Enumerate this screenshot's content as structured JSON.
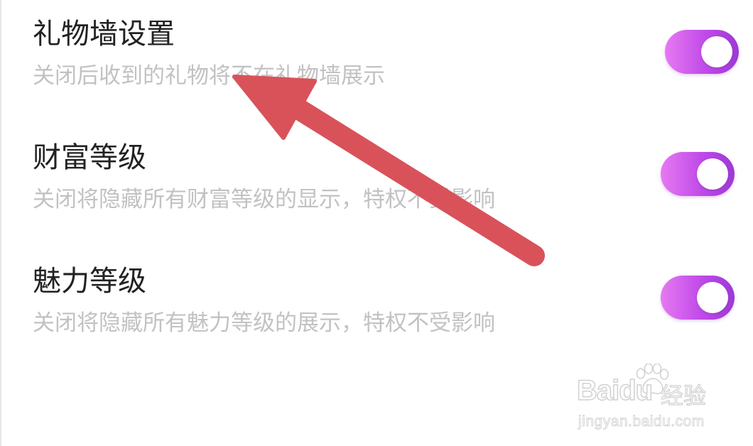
{
  "settings": [
    {
      "title": "礼物墙设置",
      "description": "关闭后收到的礼物将不在礼物墙展示",
      "enabled": true
    },
    {
      "title": "财富等级",
      "description": "关闭将隐藏所有财富等级的显示，特权不受影响",
      "enabled": true
    },
    {
      "title": "魅力等级",
      "description": "关闭将隐藏所有魅力等级的展示，特权不受影响",
      "enabled": true
    }
  ],
  "colors": {
    "toggle_on_start": "#e67af2",
    "toggle_on_end": "#9c39d6",
    "title_text": "#222222",
    "description_text": "#c2c2c2",
    "arrow": "#d9525a"
  },
  "annotation": {
    "icon": "red-arrow-icon"
  },
  "watermark": {
    "brand": "Baidu",
    "product": "经验",
    "url": "jingyan.baidu.com",
    "icon": "paw-icon"
  }
}
